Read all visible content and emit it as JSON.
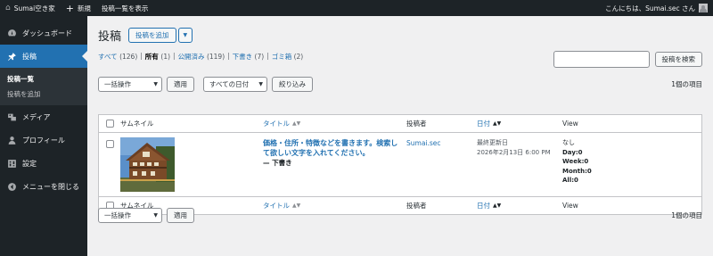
{
  "adminbar": {
    "site_name": "Sumai空き家",
    "new_label": "新規",
    "view_posts_label": "投稿一覧を表示",
    "greeting": "こんにちは、Sumai.sec さん"
  },
  "sidebar": {
    "items": [
      {
        "label": "ダッシュボード",
        "icon": "dashboard-icon"
      },
      {
        "label": "投稿",
        "icon": "pin-icon"
      },
      {
        "label": "メディア",
        "icon": "media-icon"
      },
      {
        "label": "プロフィール",
        "icon": "user-icon"
      },
      {
        "label": "設定",
        "icon": "settings-icon"
      },
      {
        "label": "メニューを閉じる",
        "icon": "collapse-icon"
      }
    ],
    "submenu": [
      {
        "label": "投稿一覧"
      },
      {
        "label": "投稿を追加"
      }
    ]
  },
  "main": {
    "title": "投稿",
    "add_new_label": "投稿を追加",
    "views": [
      {
        "label": "すべて",
        "count": "(126)"
      },
      {
        "label": "所有",
        "count": "(1)"
      },
      {
        "label": "公開済み",
        "count": "(119)"
      },
      {
        "label": "下書き",
        "count": "(7)"
      },
      {
        "label": "ゴミ箱",
        "count": "(2)"
      }
    ],
    "search_button": "投稿を検索",
    "bulk_action": "一括操作",
    "apply": "適用",
    "all_dates": "すべての日付",
    "filter": "絞り込み",
    "items_count": "1個の項目",
    "columns": {
      "thumbnail": "サムネイル",
      "title": "タイトル",
      "author": "投稿者",
      "date": "日付",
      "view": "View"
    },
    "post": {
      "title": "価格・住所・特徴などを書きます。検索して欲しい文字を入れてください。",
      "state": "— 下書き",
      "author": "Sumai.sec",
      "date_status": "最終更新日",
      "date_value": "2026年2月13日 6:00 PM",
      "view_none": "なし",
      "view_day": "Day:0",
      "view_week": "Week:0",
      "view_month": "Month:0",
      "view_all": "All:0"
    }
  },
  "colors": {
    "adminbar_bg": "#1d2327",
    "sidebar_bg": "#1d2327",
    "accent": "#2271b1",
    "page_bg": "#f0f0f1"
  }
}
